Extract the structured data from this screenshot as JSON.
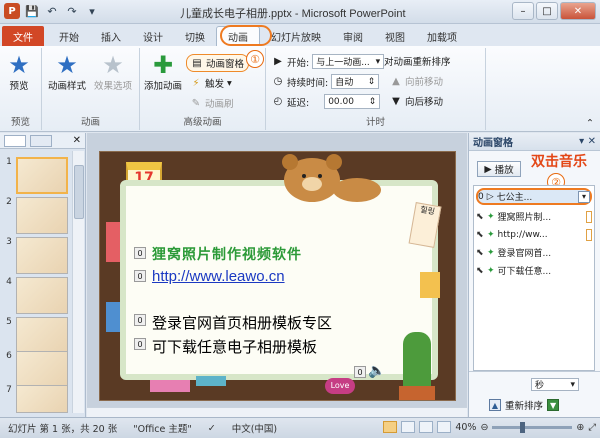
{
  "window": {
    "title": "儿童成长电子相册.pptx - Microsoft PowerPoint"
  },
  "ribbon_tabs": [
    "文件",
    "开始",
    "插入",
    "设计",
    "切换",
    "动画",
    "幻灯片放映",
    "审阅",
    "视图",
    "加载项"
  ],
  "ribbon": {
    "preview": {
      "label": "预览",
      "group": "预览"
    },
    "animation_styles": "动画样式",
    "effect_options": "效果选项",
    "animation_group": "动画",
    "add_animation": "添加动画",
    "animation_pane": "动画窗格",
    "trigger": "触发",
    "animation_painter": "动画刷",
    "advanced_group": "高级动画",
    "start_label": "开始:",
    "start_value": "与上一动画...",
    "duration_label": "持续时间:",
    "duration_value": "自动",
    "delay_label": "延迟:",
    "delay_value": "00.00",
    "reorder_title": "对动画重新排序",
    "move_earlier": "向前移动",
    "move_later": "向后移动",
    "timing_group": "计时"
  },
  "annotations": {
    "step1": "①",
    "step2": "②",
    "double_click": "双击音乐"
  },
  "slides": [
    {
      "num": "1"
    },
    {
      "num": "2"
    },
    {
      "num": "3"
    },
    {
      "num": "4"
    },
    {
      "num": "5"
    },
    {
      "num": "6"
    },
    {
      "num": "7"
    }
  ],
  "slide_content": {
    "calendar_day": "17",
    "line1": "狸窝照片制作视频软件",
    "url": "http://www.leawo.cn",
    "line3": "登录官网首页相册模板专区",
    "line4": "可下载任意电子相册模板",
    "love": "Love",
    "tag_labels": [
      "0",
      "0",
      "0",
      "0",
      "0"
    ],
    "note_text": "힐링"
  },
  "animation_pane": {
    "title": "动画窗格",
    "play": "播放",
    "items": [
      {
        "index": "0",
        "label": "七公主..."
      },
      {
        "index": "",
        "label": "狸窝照片制..."
      },
      {
        "index": "",
        "label": "http://ww..."
      },
      {
        "index": "",
        "label": "登录官网首..."
      },
      {
        "index": "",
        "label": "可下载任意..."
      }
    ],
    "seconds": "秒",
    "reorder": "重新排序"
  },
  "statusbar": {
    "slide_info": "幻灯片 第 1 张，共 20 张",
    "theme": "\"Office 主题\"",
    "language": "中文(中国)",
    "zoom": "40%"
  }
}
